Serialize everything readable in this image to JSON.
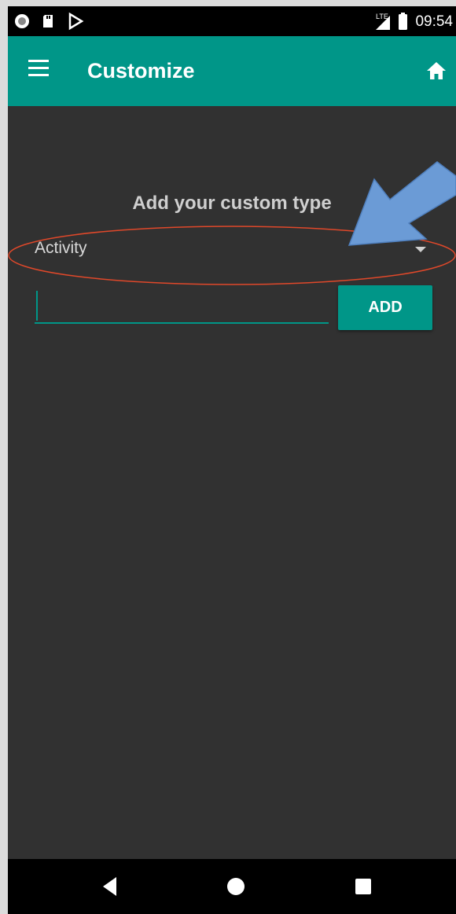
{
  "status_bar": {
    "time": "09:54",
    "network_label": "LTE",
    "icons": [
      "record-icon",
      "sd-card-icon",
      "play-store-icon",
      "signal-icon",
      "battery-icon"
    ]
  },
  "app_bar": {
    "title": "Customize",
    "menu_icon": "hamburger-menu-icon",
    "home_icon": "home-icon",
    "color": "#009688"
  },
  "content": {
    "heading": "Add your custom type",
    "type_select": {
      "selected": "Activity"
    },
    "input": {
      "value": "",
      "placeholder": ""
    },
    "add_button_label": "ADD"
  },
  "annotations": {
    "highlight_color": "#e0482a",
    "arrow_color": "#6b9bd6"
  },
  "nav_bar": {
    "buttons": [
      "back-icon",
      "home-circle-icon",
      "recents-icon"
    ]
  }
}
